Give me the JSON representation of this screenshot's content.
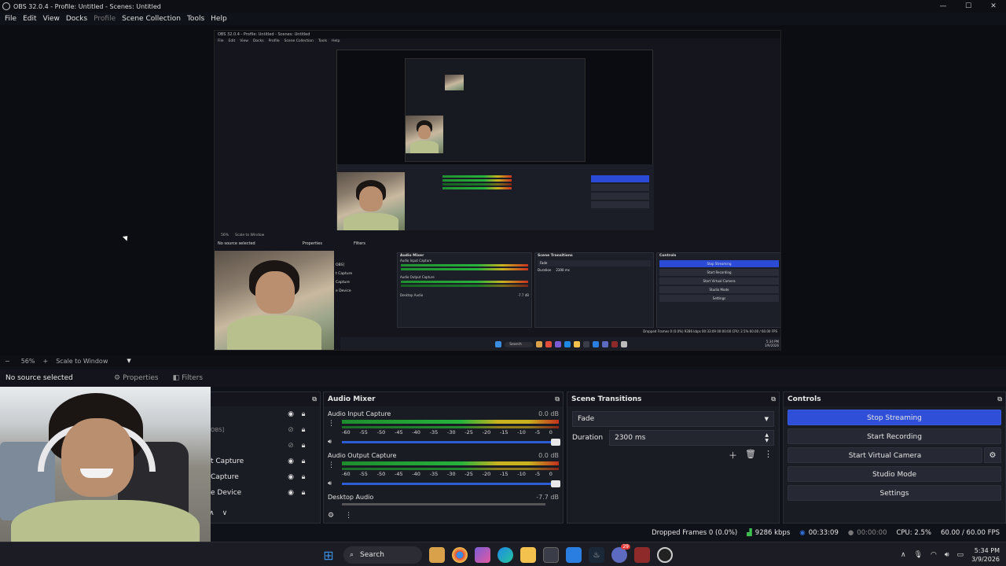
{
  "window": {
    "title": "OBS 32.0.4 - Profile: Untitled - Scenes: Untitled",
    "min": "—",
    "max": "☐",
    "close": "✕"
  },
  "menu": [
    "File",
    "Edit",
    "View",
    "Docks",
    "Profile",
    "Scene Collection",
    "Tools",
    "Help"
  ],
  "nested": {
    "title": "OBS 32.0.4 - Profile: Untitled - Scenes: Untitled",
    "menu": [
      "File",
      "Edit",
      "View",
      "Docks",
      "Profile",
      "Scene Collection",
      "Tools",
      "Help"
    ],
    "no_source": "No source selected",
    "properties": "Properties",
    "filters": "Filters",
    "zoom": "56%",
    "scale": "Scale to Window",
    "audio_mixer": "Audio Mixer",
    "audio_input": "Audio Input Capture",
    "audio_output": "Audio Output Capture",
    "desktop_audio": "Desktop Audio",
    "desktop_db": "-7.7 dB",
    "scene_transitions": "Scene Transitions",
    "fade": "Fade",
    "duration": "Duration",
    "duration_val": "2300 ms",
    "controls": "Controls",
    "stop_streaming": "Stop Streaming",
    "start_recording": "Start Recording",
    "start_virtual_camera": "Start Virtual Camera",
    "studio_mode": "Studio Mode",
    "settings": "Settings",
    "src_rows": [
      "OBS]",
      "t Capture",
      "Capture",
      "e Device"
    ],
    "status": "Dropped Frames 0 (0.0%)   9286 kbps   00:33:09   00:00:00   CPU: 2.5%   60.00 / 60.00 FPS",
    "clock_time": "5:34 PM",
    "clock_date": "3/9/2026",
    "search": "Search"
  },
  "zoombar": {
    "minus": "−",
    "zoom": "56%",
    "plus": "+",
    "scale": "Scale to Window"
  },
  "sourcebar": {
    "no_source": "No source selected",
    "properties": "Properties",
    "filters": "Filters"
  },
  "sources": {
    "rows": [
      {
        "label": "",
        "visible": "eye",
        "locked": true
      },
      {
        "label": "OBS]",
        "visible": "hidden",
        "locked": true
      },
      {
        "label": "",
        "visible": "hidden",
        "locked": true
      },
      {
        "label": "t Capture",
        "visible": "eye",
        "locked": true
      },
      {
        "label": "Capture",
        "visible": "eye",
        "locked": true
      },
      {
        "label": "e Device",
        "visible": "eye",
        "locked": true
      }
    ]
  },
  "audio_mixer": {
    "title": "Audio Mixer",
    "ticks": [
      "-60",
      "-55",
      "-50",
      "-45",
      "-40",
      "-35",
      "-30",
      "-25",
      "-20",
      "-15",
      "-10",
      "-5",
      "0"
    ],
    "channels": [
      {
        "name": "Audio Input Capture",
        "db": "0.0 dB",
        "level": 0.98,
        "volume": 1.0
      },
      {
        "name": "Audio Output Capture",
        "db": "0.0 dB",
        "level": 0.98,
        "volume": 1.0
      },
      {
        "name": "Desktop Audio",
        "db": "-7.7 dB",
        "level": 0.0,
        "volume": 0.88
      }
    ]
  },
  "scene_transitions": {
    "title": "Scene Transitions",
    "transition": "Fade",
    "duration_label": "Duration",
    "duration_value": "2300 ms"
  },
  "controls": {
    "title": "Controls",
    "stop_streaming": "Stop Streaming",
    "start_recording": "Start Recording",
    "start_virtual_camera": "Start Virtual Camera",
    "studio_mode": "Studio Mode",
    "settings": "Settings"
  },
  "status": {
    "dropped": "Dropped Frames 0 (0.0%)",
    "bitrate": "9286 kbps",
    "stream_time": "00:33:09",
    "rec_time": "00:00:00",
    "cpu": "CPU: 2.5%",
    "fps": "60.00 / 60.00 FPS"
  },
  "taskbar": {
    "search": "Search",
    "time": "5:34 PM",
    "date": "3/9/2026",
    "badge": "29"
  },
  "colors": {
    "accent_blue": "#2f4fd8",
    "meter_green": "#26b33b",
    "meter_yellow": "#c8b21f",
    "meter_red": "#c2301d"
  }
}
